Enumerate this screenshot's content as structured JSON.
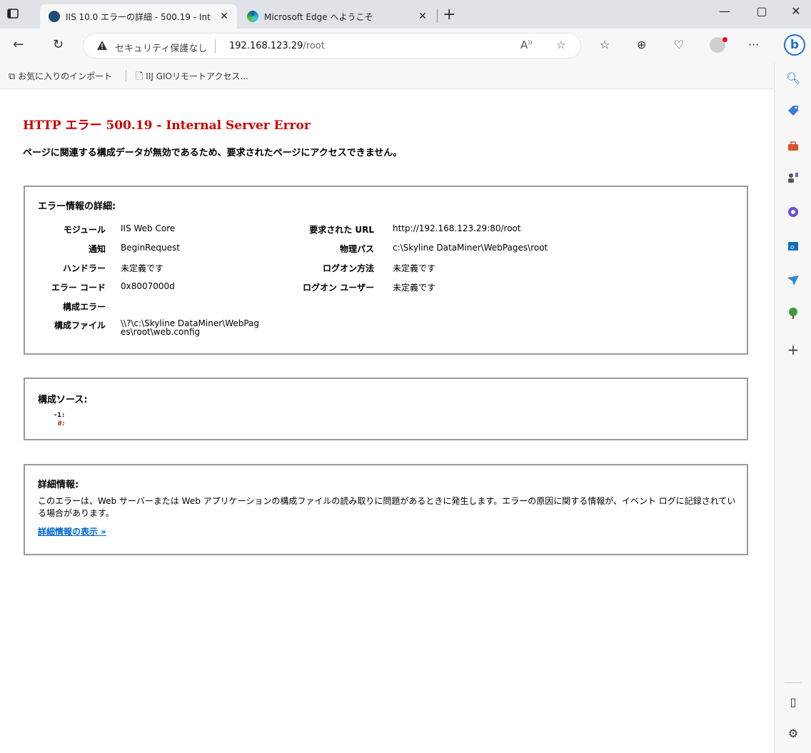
{
  "browser": {
    "tabs": [
      {
        "title": "IIS 10.0 エラーの詳細 - 500.19 - Int",
        "active": true
      },
      {
        "title": "Microsoft Edge へようこそ",
        "active": false
      }
    ],
    "address": {
      "security_label": "セキュリティ保護なし",
      "host": "192.168.123.29",
      "path": "/root"
    },
    "favorites": [
      {
        "label": "お気に入りのインポート"
      },
      {
        "label": "IIJ GIOリモートアクセス..."
      }
    ],
    "colors": {
      "error_red": "#cc0000",
      "link_blue": "#0066cc",
      "accent": "#1b6ed8"
    }
  },
  "page": {
    "title": "HTTP エラー 500.19 - Internal Server Error",
    "subtitle": "ページに関連する構成データが無効であるため、要求されたページにアクセスできません。",
    "details": {
      "heading": "エラー情報の詳細:",
      "left": [
        {
          "label": "モジュール",
          "value": "IIS Web Core"
        },
        {
          "label": "通知",
          "value": "BeginRequest"
        },
        {
          "label": "ハンドラー",
          "value": "未定義です"
        },
        {
          "label": "エラー コード",
          "value": "0x8007000d"
        },
        {
          "label": "構成エラー",
          "value": ""
        },
        {
          "label": "構成ファイル",
          "value_line1": "\\\\?\\c:\\Skyline DataMiner\\WebPag",
          "value_line2": "es\\root\\web.config"
        }
      ],
      "right": [
        {
          "label": "要求された URL",
          "value": "http://192.168.123.29:80/root"
        },
        {
          "label": "物理パス",
          "value": "c:\\Skyline DataMiner\\WebPages\\root"
        },
        {
          "label": "ログオン方法",
          "value": "未定義です"
        },
        {
          "label": "ログオン ユーザー",
          "value": "未定義です"
        }
      ]
    },
    "config_source": {
      "heading": "構成ソース:",
      "lines": [
        "-1:",
        "0:"
      ]
    },
    "more_info": {
      "heading": "詳細情報:",
      "text": "このエラーは、Web サーバーまたは Web アプリケーションの構成ファイルの読み取りに問題があるときに発生します。エラーの原因に関する情報が、イベント ログに記録されている場合があります。",
      "link": "詳細情報の表示 »"
    }
  }
}
